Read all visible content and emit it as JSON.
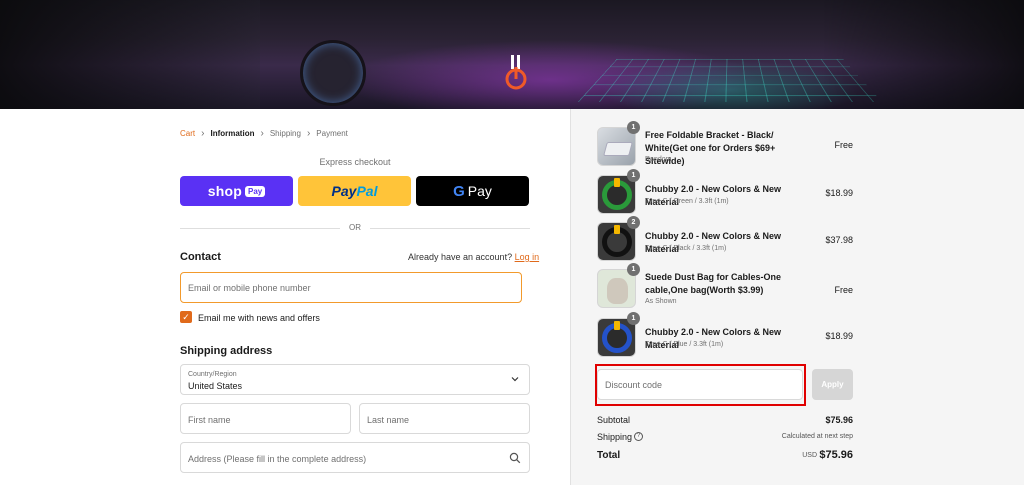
{
  "breadcrumb": {
    "cart": "Cart",
    "information": "Information",
    "shipping": "Shipping",
    "payment": "Payment"
  },
  "express": {
    "label": "Express checkout",
    "shop_word": "shop",
    "shop_tag": "Pay",
    "paypal_1": "Pay",
    "paypal_2": "Pal",
    "gpay_g": "G",
    "gpay_word": "Pay"
  },
  "divider": "OR",
  "contact": {
    "title": "Contact",
    "account_text": "Already have an account?",
    "login": "Log in",
    "email_placeholder": "Email or mobile phone number",
    "newsletter_label": "Email me with news and offers",
    "newsletter_checked": true
  },
  "shipping_address": {
    "title": "Shipping address",
    "country_label": "Country/Region",
    "country_value": "United States",
    "first_name_placeholder": "First name",
    "last_name_placeholder": "Last name",
    "address_placeholder": "Address (Please fill in the complete address)"
  },
  "items": [
    {
      "name": "Free Foldable Bracket - Black/ White(Get one for Orders $69+ Sitewide)",
      "variant": "Random",
      "price": "Free",
      "qty": "1"
    },
    {
      "name": "Chubby 2.0 - New Colors & New Material",
      "variant": "Type-C / Green / 3.3ft (1m)",
      "price": "$18.99",
      "qty": "1"
    },
    {
      "name": "Chubby 2.0 - New Colors & New Material",
      "variant": "Type-C / Black / 3.3ft (1m)",
      "price": "$37.98",
      "qty": "2"
    },
    {
      "name": "Suede Dust Bag for Cables-One cable,One bag(Worth $3.99)",
      "variant": "As Shown",
      "price": "Free",
      "qty": "1"
    },
    {
      "name": "Chubby 2.0 - New Colors & New Material",
      "variant": "Type-C / Blue / 3.3ft (1m)",
      "price": "$18.99",
      "qty": "1"
    }
  ],
  "discount": {
    "placeholder": "Discount code",
    "apply_label": "Apply"
  },
  "totals": {
    "subtotal_label": "Subtotal",
    "subtotal_value": "$75.96",
    "shipping_label": "Shipping",
    "shipping_info": "?",
    "shipping_value": "Calculated at next step",
    "total_label": "Total",
    "currency": "USD",
    "total_value": "$75.96"
  },
  "colors": {
    "accent": "#e06a1b",
    "shop_pay": "#5a31f4",
    "paypal": "#ffc439",
    "highlight": "#e00000"
  },
  "icons": {
    "logo": "cable-logo-icon",
    "chevron": "chevron-down-icon",
    "search": "search-icon",
    "check": "check-icon"
  }
}
